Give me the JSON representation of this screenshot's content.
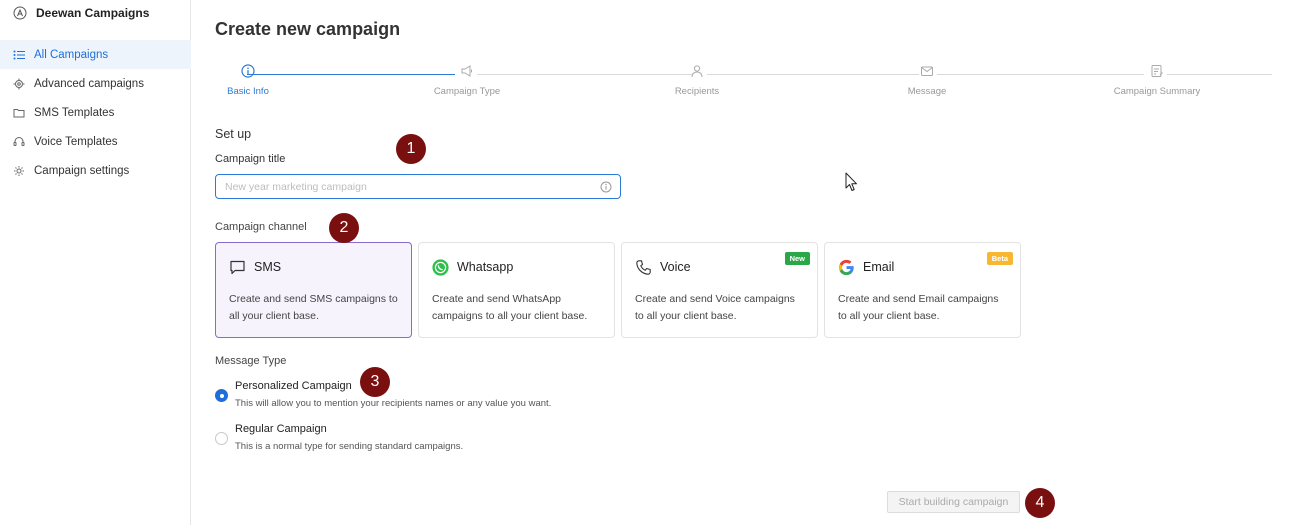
{
  "sidebar": {
    "brand": "Deewan Campaigns",
    "items": [
      {
        "label": "All Campaigns",
        "icon": "list-icon",
        "active": true
      },
      {
        "label": "Advanced campaigns",
        "icon": "gear-sparkle-icon"
      },
      {
        "label": "SMS Templates",
        "icon": "folder-icon"
      },
      {
        "label": "Voice Templates",
        "icon": "headset-icon"
      },
      {
        "label": "Campaign settings",
        "icon": "gear-icon"
      }
    ]
  },
  "page": {
    "title": "Create new campaign"
  },
  "stepper": {
    "steps": [
      {
        "label": "Basic Info",
        "icon": "info-icon",
        "active": true
      },
      {
        "label": "Campaign Type",
        "icon": "megaphone-icon"
      },
      {
        "label": "Recipients",
        "icon": "user-icon"
      },
      {
        "label": "Message",
        "icon": "envelope-icon"
      },
      {
        "label": "Campaign Summary",
        "icon": "summary-icon"
      }
    ]
  },
  "setup": {
    "section_title": "Set up",
    "campaign_title_label": "Campaign title",
    "campaign_title_placeholder": "New year marketing campaign",
    "campaign_title_value": ""
  },
  "channel": {
    "label": "Campaign channel",
    "options": [
      {
        "name": "SMS",
        "desc": "Create and send SMS campaigns to all your client base.",
        "icon": "chat-bubble-icon",
        "selected": true,
        "badge": ""
      },
      {
        "name": "Whatsapp",
        "desc": "Create and send WhatsApp campaigns to all your client base.",
        "icon": "whatsapp-icon",
        "selected": false,
        "badge": ""
      },
      {
        "name": "Voice",
        "desc": "Create and send Voice campaigns to all your client base.",
        "icon": "phone-icon",
        "selected": false,
        "badge": "New"
      },
      {
        "name": "Email",
        "desc": "Create and send Email campaigns to all your client base.",
        "icon": "google-icon",
        "selected": false,
        "badge": "Beta"
      }
    ]
  },
  "message_type": {
    "label": "Message Type",
    "options": [
      {
        "title": "Personalized Campaign",
        "desc": "This will allow you to mention your recipients names or any value you want.",
        "checked": true
      },
      {
        "title": "Regular Campaign",
        "desc": "This is a normal type for sending standard campaigns.",
        "checked": false
      }
    ]
  },
  "actions": {
    "start_label": "Start building campaign"
  },
  "markers": [
    "1",
    "2",
    "3",
    "4"
  ],
  "colors": {
    "accent": "#1e6fd9",
    "selected_card_bg": "#f7f3fd",
    "selected_card_border": "#8a6bc9",
    "marker": "#7a0f0f",
    "badge_new": "#2aa747",
    "badge_beta": "#f7b733"
  }
}
